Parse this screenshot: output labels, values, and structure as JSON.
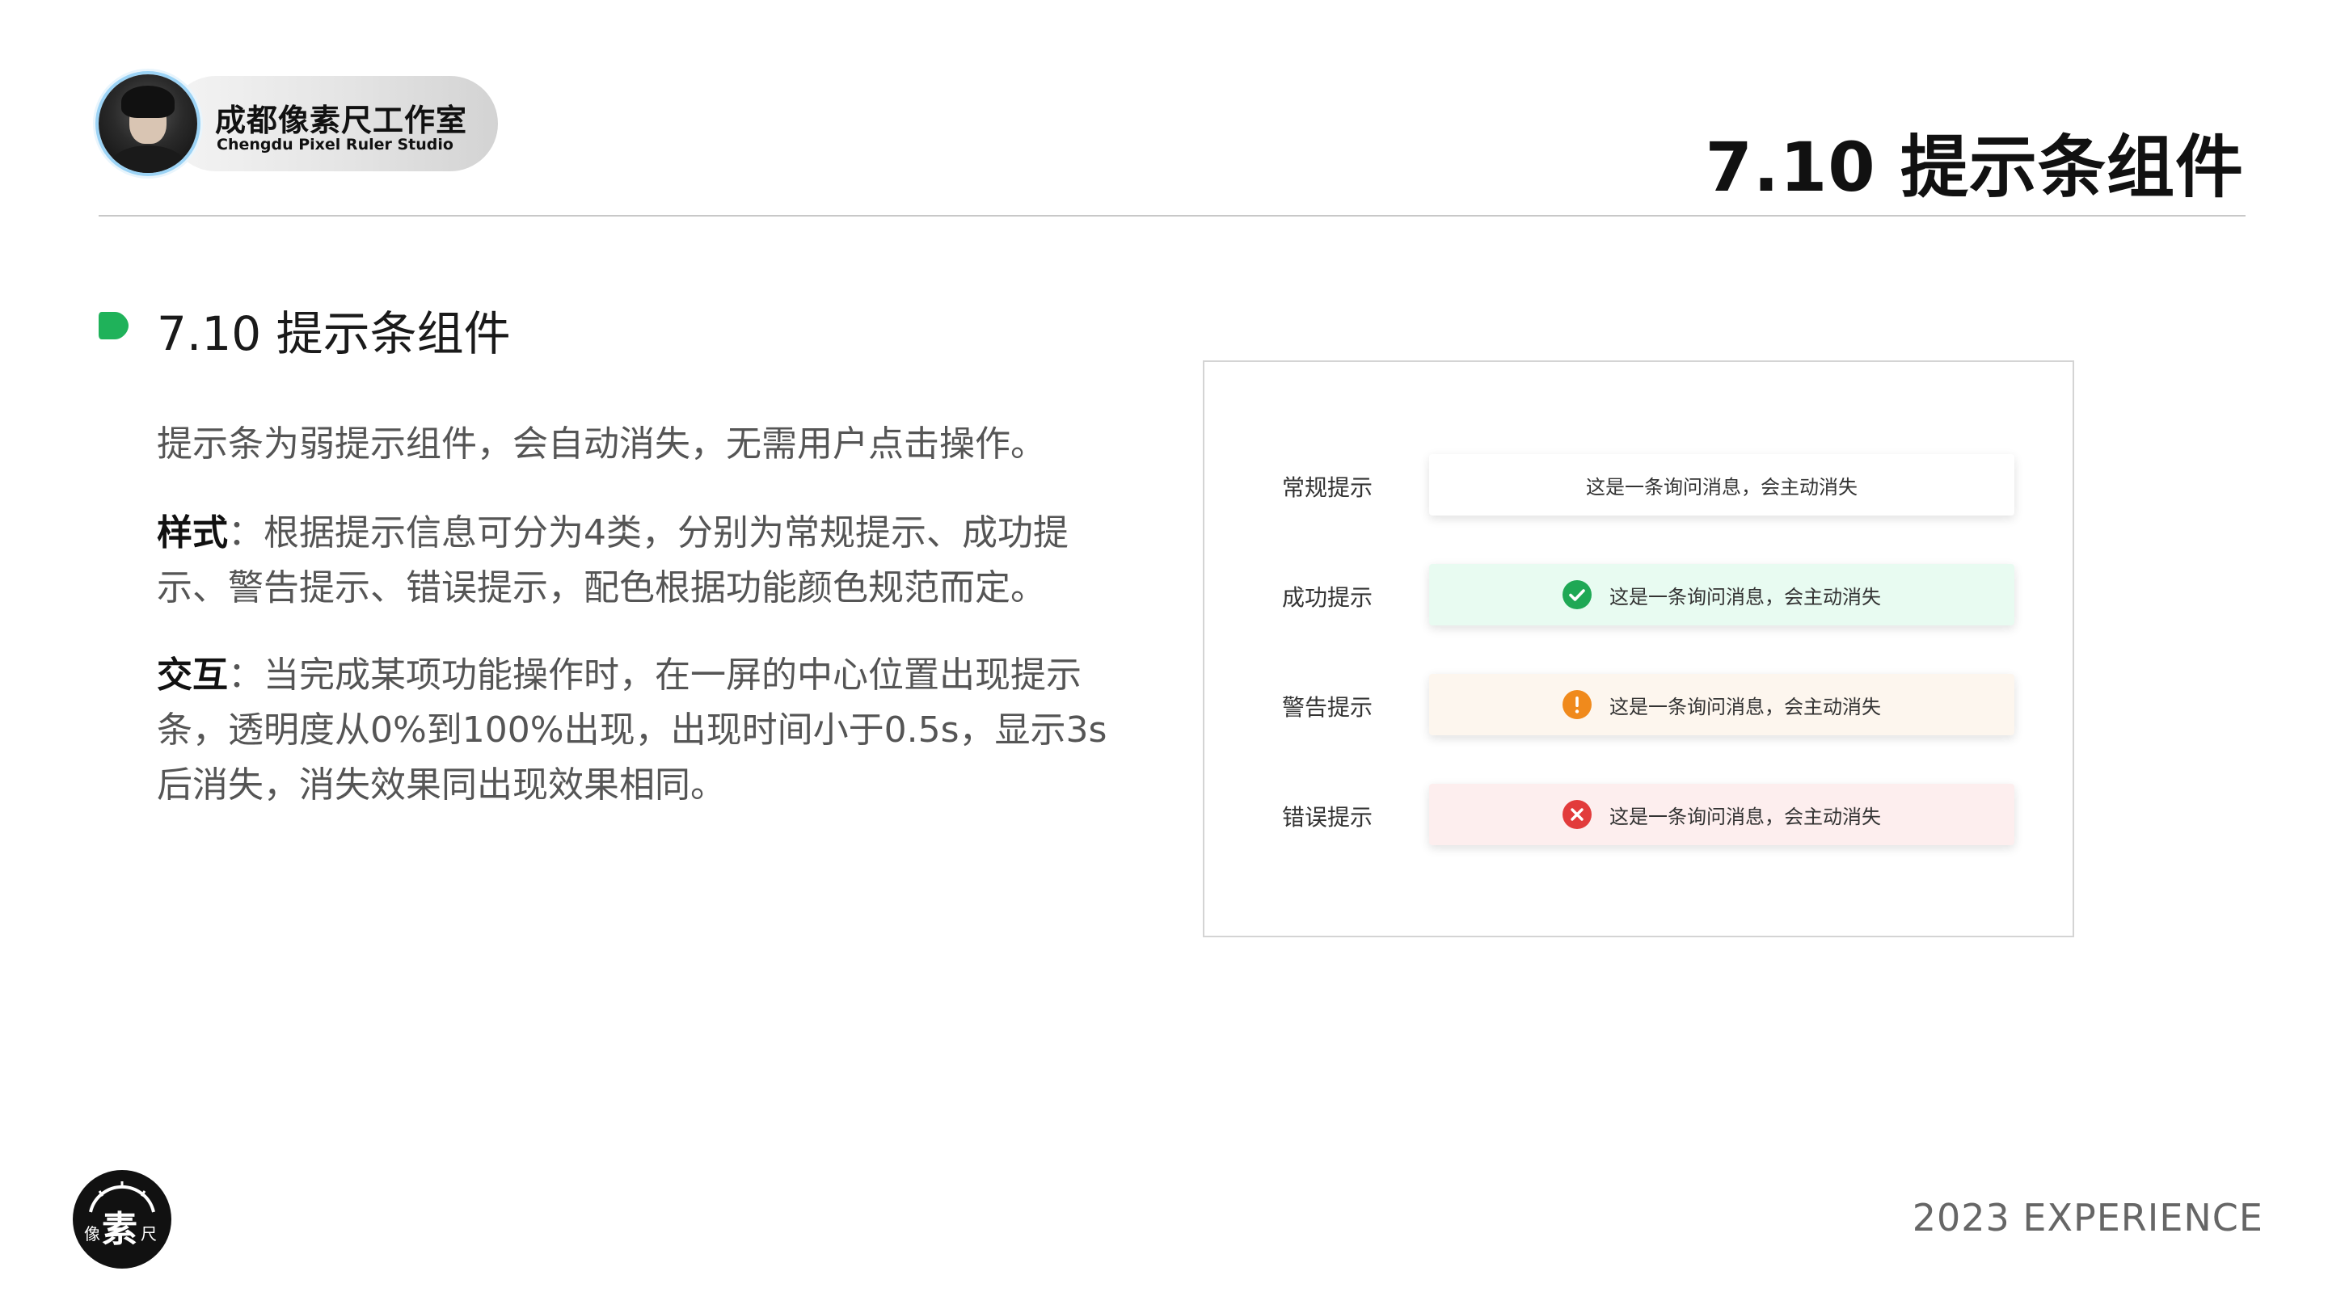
{
  "brand": {
    "name": "成都像素尺工作室",
    "subtitle": "Chengdu Pixel Ruler Studio"
  },
  "header": {
    "title": "7.10 提示条组件"
  },
  "section": {
    "title": "7.10 提示条组件",
    "marker_color": "#1fb25a"
  },
  "body": {
    "p1": "提示条为弱提示组件，会自动消失，无需用户点击操作。",
    "p2_label": "样式",
    "p2_sep": "：",
    "p2_text": "根据提示信息可分为4类，分别为常规提示、成功提示、警告提示、错误提示，配色根据功能颜色规范而定。",
    "p3_label": "交互",
    "p3_sep": "：",
    "p3_text": "当完成某项功能操作时，在一屏的中心位置出现提示条，透明度从0%到100%出现，出现时间小于0.5s，显示3s后消失，消失效果同出现效果相同。"
  },
  "demo": {
    "rows": [
      {
        "label": "常规提示",
        "message": "这是一条询问消息，会主动消失",
        "icon": "none",
        "bg": "#ffffff"
      },
      {
        "label": "成功提示",
        "message": "这是一条询问消息，会主动消失",
        "icon": "check-circle-icon",
        "color": "#1fa855",
        "bg": "#e8fbf1"
      },
      {
        "label": "警告提示",
        "message": "这是一条询问消息，会主动消失",
        "icon": "exclamation-circle-icon",
        "color": "#f08a1c",
        "bg": "#fdf6ee"
      },
      {
        "label": "错误提示",
        "message": "这是一条询问消息，会主动消失",
        "icon": "close-circle-icon",
        "color": "#e23b3b",
        "bg": "#fdeeee"
      }
    ]
  },
  "footer": {
    "logo_text_left": "像",
    "logo_text_mid": "素",
    "logo_text_right": "尺",
    "text": "2023  EXPERIENCE"
  }
}
